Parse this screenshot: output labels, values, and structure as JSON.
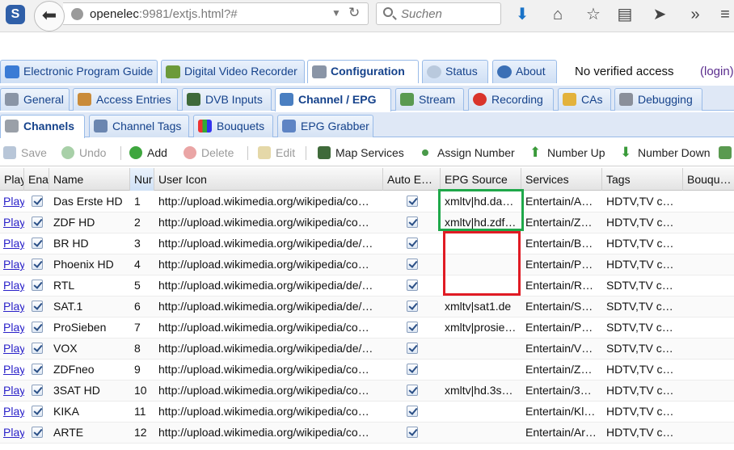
{
  "browser": {
    "url_host": "openelec",
    "url_rest": ":9981/extjs.html?#",
    "search_placeholder": "Suchen"
  },
  "main_tabs": [
    {
      "label": "Electronic Program Guide",
      "icon": "epg-icon"
    },
    {
      "label": "Digital Video Recorder",
      "icon": "dvr-icon"
    },
    {
      "label": "Configuration",
      "icon": "wrench-icon",
      "active": true
    },
    {
      "label": "Status",
      "icon": "eye-icon"
    },
    {
      "label": "About",
      "icon": "info-icon"
    }
  ],
  "access_text": "No verified access",
  "login_text": "(login)",
  "config_tabs": [
    {
      "label": "General",
      "icon": "wrench-icon"
    },
    {
      "label": "Access Entries",
      "icon": "users-icon"
    },
    {
      "label": "DVB Inputs",
      "icon": "dvb-icon"
    },
    {
      "label": "Channel / EPG",
      "icon": "tv-icon",
      "active": true
    },
    {
      "label": "Stream",
      "icon": "stream-icon"
    },
    {
      "label": "Recording",
      "icon": "rec-icon"
    },
    {
      "label": "CAs",
      "icon": "key-icon"
    },
    {
      "label": "Debugging",
      "icon": "bug-icon"
    }
  ],
  "channel_tabs": [
    {
      "label": "Channels",
      "icon": "remote-icon",
      "active": true
    },
    {
      "label": "Channel Tags",
      "icon": "tags-icon"
    },
    {
      "label": "Bouquets",
      "icon": "bouquets-icon"
    },
    {
      "label": "EPG Grabber",
      "icon": "code-icon"
    }
  ],
  "toolbar": {
    "save": "Save",
    "undo": "Undo",
    "add": "Add",
    "delete": "Delete",
    "edit": "Edit",
    "map_services": "Map Services",
    "assign_number": "Assign Number",
    "number_up": "Number Up",
    "number_down": "Number Down"
  },
  "grid": {
    "columns": [
      "Play",
      "Enabled",
      "Name",
      "Number",
      "User Icon",
      "Auto EPG",
      "EPG Source",
      "Services",
      "Tags",
      "Bouquet"
    ],
    "header_labels": [
      "Play",
      "Ena",
      "Name",
      "Nur",
      "User Icon",
      "Auto E…",
      "EPG Source",
      "Services",
      "Tags",
      "Bouqu…"
    ],
    "rows": [
      {
        "play": "Play",
        "enabled": true,
        "name": "Das Erste HD",
        "number": "1",
        "icon": "http://upload.wikimedia.org/wikipedia/co…",
        "auto_epg": true,
        "epg": "xmltv|hd.da…",
        "services": "Entertain/A…",
        "tags": "HDTV,TV c…"
      },
      {
        "play": "Play",
        "enabled": true,
        "name": "ZDF HD",
        "number": "2",
        "icon": "http://upload.wikimedia.org/wikipedia/co…",
        "auto_epg": true,
        "epg": "xmltv|hd.zdf…",
        "services": "Entertain/Z…",
        "tags": "HDTV,TV c…"
      },
      {
        "play": "Play",
        "enabled": true,
        "name": "BR HD",
        "number": "3",
        "icon": "http://upload.wikimedia.org/wikipedia/de/…",
        "auto_epg": true,
        "epg": "",
        "services": "Entertain/B…",
        "tags": "HDTV,TV c…"
      },
      {
        "play": "Play",
        "enabled": true,
        "name": "Phoenix HD",
        "number": "4",
        "icon": "http://upload.wikimedia.org/wikipedia/co…",
        "auto_epg": true,
        "epg": "",
        "services": "Entertain/P…",
        "tags": "HDTV,TV c…"
      },
      {
        "play": "Play",
        "enabled": true,
        "name": "RTL",
        "number": "5",
        "icon": "http://upload.wikimedia.org/wikipedia/de/…",
        "auto_epg": true,
        "epg": "",
        "services": "Entertain/R…",
        "tags": "SDTV,TV c…"
      },
      {
        "play": "Play",
        "enabled": true,
        "name": "SAT.1",
        "number": "6",
        "icon": "http://upload.wikimedia.org/wikipedia/de/…",
        "auto_epg": true,
        "epg": "xmltv|sat1.de",
        "services": "Entertain/S…",
        "tags": "SDTV,TV c…"
      },
      {
        "play": "Play",
        "enabled": true,
        "name": "ProSieben",
        "number": "7",
        "icon": "http://upload.wikimedia.org/wikipedia/co…",
        "auto_epg": true,
        "epg": "xmltv|prosie…",
        "services": "Entertain/P…",
        "tags": "SDTV,TV c…"
      },
      {
        "play": "Play",
        "enabled": true,
        "name": "VOX",
        "number": "8",
        "icon": "http://upload.wikimedia.org/wikipedia/de/…",
        "auto_epg": true,
        "epg": "",
        "services": "Entertain/V…",
        "tags": "SDTV,TV c…"
      },
      {
        "play": "Play",
        "enabled": true,
        "name": "ZDFneo",
        "number": "9",
        "icon": "http://upload.wikimedia.org/wikipedia/co…",
        "auto_epg": true,
        "epg": "",
        "services": "Entertain/Z…",
        "tags": "HDTV,TV c…"
      },
      {
        "play": "Play",
        "enabled": true,
        "name": "3SAT HD",
        "number": "10",
        "icon": "http://upload.wikimedia.org/wikipedia/co…",
        "auto_epg": true,
        "epg": "xmltv|hd.3s…",
        "services": "Entertain/3…",
        "tags": "HDTV,TV c…"
      },
      {
        "play": "Play",
        "enabled": true,
        "name": "KIKA",
        "number": "11",
        "icon": "http://upload.wikimedia.org/wikipedia/co…",
        "auto_epg": true,
        "epg": "",
        "services": "Entertain/Kl…",
        "tags": "HDTV,TV c…"
      },
      {
        "play": "Play",
        "enabled": true,
        "name": "ARTE",
        "number": "12",
        "icon": "http://upload.wikimedia.org/wikipedia/co…",
        "auto_epg": true,
        "epg": "",
        "services": "Entertain/Ar…",
        "tags": "HDTV,TV c…"
      }
    ]
  },
  "colors": {
    "highlight_green": "#1fa84a",
    "highlight_red": "#e01b24",
    "link": "#2a21c9",
    "tab_text": "#15428b"
  }
}
